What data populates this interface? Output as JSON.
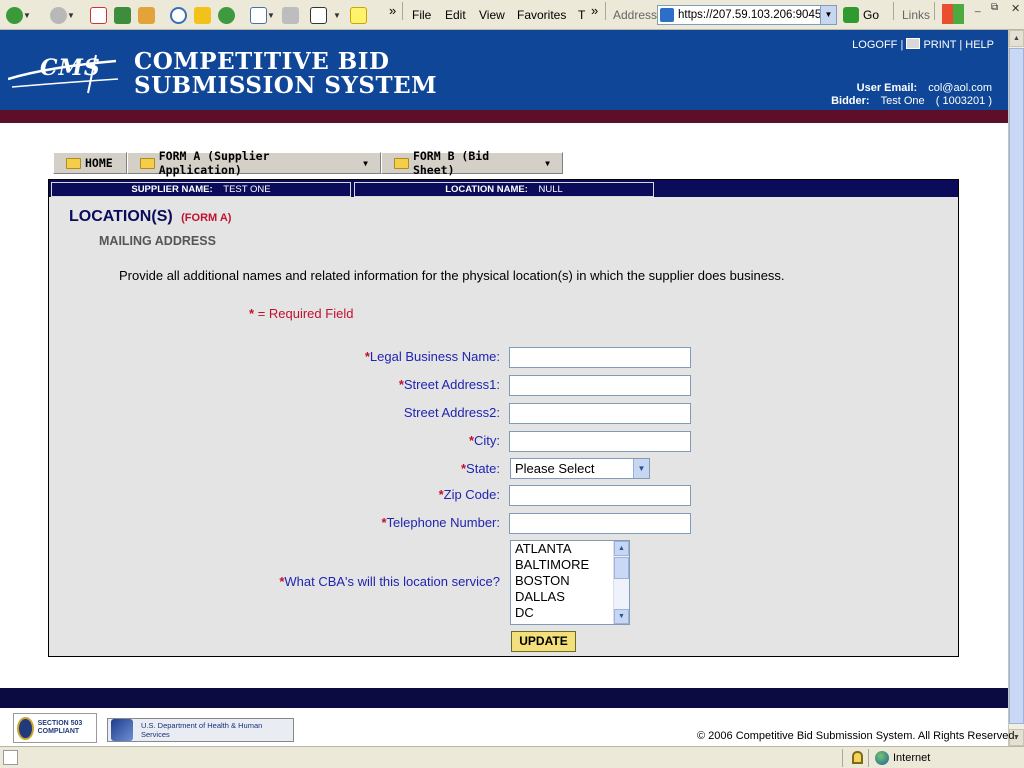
{
  "browser": {
    "menu": [
      "File",
      "Edit",
      "View",
      "Favorites",
      "T"
    ],
    "address_label": "Address",
    "address_value": "https://207.59.103.206:9045",
    "go_label": "Go",
    "links_label": "Links",
    "chevron": "»",
    "status_zone": "Internet"
  },
  "header": {
    "logo_text": "CMS",
    "title_line1": "COMPETITIVE BID",
    "title_line2": "SUBMISSION SYSTEM",
    "links": {
      "logoff": "LOGOFF",
      "print": "PRINT",
      "help": "HELP",
      "sep": "|"
    },
    "user_email_label": "User Email:",
    "user_email": "col@aol.com",
    "bidder_label": "Bidder:",
    "bidder_name": "Test One",
    "bidder_id": "( 1003201 )"
  },
  "tabs": [
    {
      "label": "HOME"
    },
    {
      "label": "FORM A (Supplier Application)"
    },
    {
      "label": "FORM B (Bid Sheet)"
    }
  ],
  "info_bar": {
    "supplier_label": "SUPPLIER NAME:",
    "supplier_value": "TEST ONE",
    "location_label": "LOCATION NAME:",
    "location_value": "NULL"
  },
  "page": {
    "title": "LOCATION(S)",
    "subtitle": "(FORM A)",
    "section": "MAILING ADDRESS",
    "description": "Provide all additional names and related information for the physical location(s) in which the supplier does business.",
    "required_note": "= Required Field"
  },
  "form": {
    "legal_name_label": "Legal Business Name:",
    "street1_label": "Street Address1:",
    "street2_label": "Street Address2:",
    "city_label": "City:",
    "state_label": "State:",
    "state_value": "Please Select",
    "zip_label": "Zip Code:",
    "phone_label": "Telephone Number:",
    "cba_label": "What CBA's will this location service?",
    "cba_options": [
      "ATLANTA",
      "BALTIMORE",
      "BOSTON",
      "DALLAS",
      "DC"
    ],
    "update_label": "UPDATE",
    "required_mark": "*"
  },
  "footer": {
    "badge_508": "SECTION 503 COMPLIANT",
    "hhs_text": "U.S. Department of Health & Human Services",
    "copyright": "© 2006 Competitive Bid Submission System. All Rights Reserved."
  }
}
